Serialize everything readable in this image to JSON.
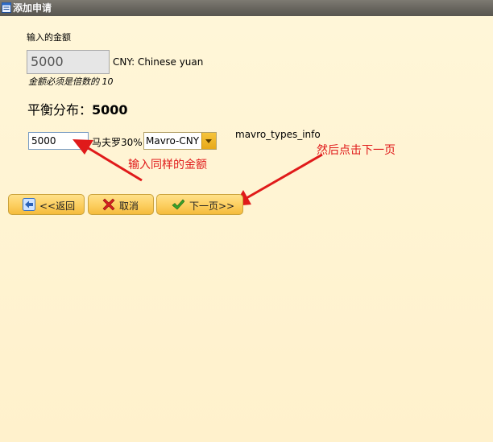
{
  "window": {
    "title": "添加申请"
  },
  "form": {
    "amount_label": "输入的金额",
    "amount_value": "5000",
    "currency": "CNY: Chinese yuan",
    "hint": "金额必须是倍数的 10",
    "balance_label": "平衡分布：",
    "balance_value": "5000",
    "dist_value": "5000",
    "mavro_label": "马夫罗30%",
    "select_value": "Mavro-CNY",
    "types_info": "mavro_types_info"
  },
  "annotations": {
    "input_hint": "输入同样的金额",
    "next_hint": "然后点击下一页",
    "color": "#e01a1a"
  },
  "buttons": {
    "back": "<<返回",
    "cancel": "取消",
    "next": "下一页>>"
  },
  "icons": {
    "app": "window-app-icon",
    "back": "back-arrow-icon",
    "cancel": "cancel-x-icon",
    "next": "checkmark-icon"
  }
}
